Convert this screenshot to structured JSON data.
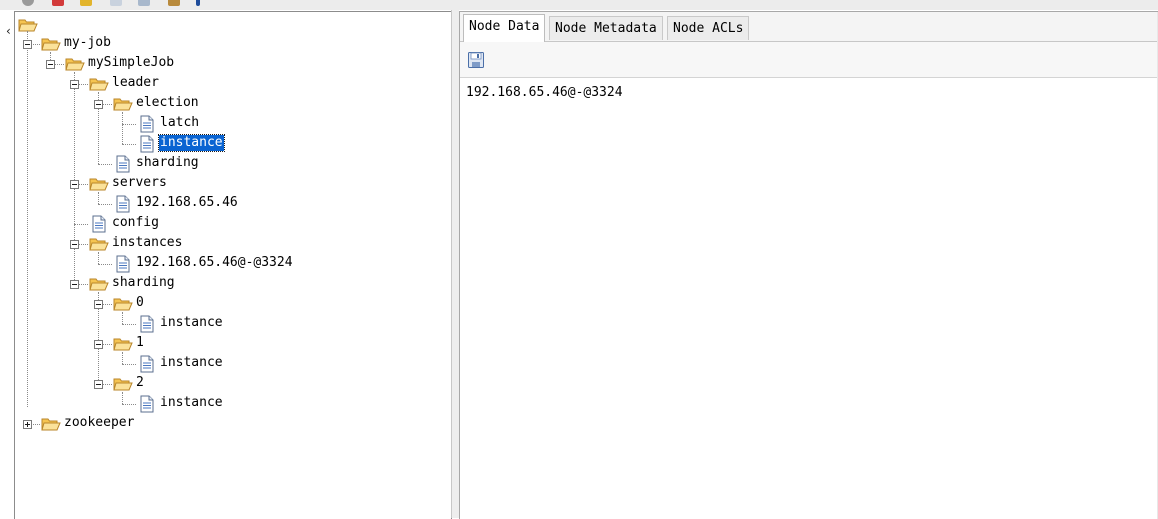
{
  "tree": {
    "nodes": [
      {
        "label": "my-job",
        "type": "folder",
        "expander": "minus"
      },
      {
        "label": "mySimpleJob",
        "type": "folder",
        "expander": "minus"
      },
      {
        "label": "leader",
        "type": "folder",
        "expander": "minus"
      },
      {
        "label": "election",
        "type": "folder",
        "expander": "minus"
      },
      {
        "label": "latch",
        "type": "file"
      },
      {
        "label": "instance",
        "type": "file",
        "selected": true
      },
      {
        "label": "sharding",
        "type": "file"
      },
      {
        "label": "servers",
        "type": "folder",
        "expander": "minus"
      },
      {
        "label": "192.168.65.46",
        "type": "file"
      },
      {
        "label": "config",
        "type": "file"
      },
      {
        "label": "instances",
        "type": "folder",
        "expander": "minus"
      },
      {
        "label": "192.168.65.46@-@3324",
        "type": "file"
      },
      {
        "label": "sharding",
        "type": "folder",
        "expander": "minus"
      },
      {
        "label": "0",
        "type": "folder",
        "expander": "minus"
      },
      {
        "label": "instance",
        "type": "file"
      },
      {
        "label": "1",
        "type": "folder",
        "expander": "minus"
      },
      {
        "label": "instance",
        "type": "file"
      },
      {
        "label": "2",
        "type": "folder",
        "expander": "minus"
      },
      {
        "label": "instance",
        "type": "file"
      },
      {
        "label": "zookeeper",
        "type": "folder",
        "expander": "plus"
      }
    ]
  },
  "tabs": [
    {
      "label": "Node Data",
      "active": true
    },
    {
      "label": "Node Metadata",
      "active": false
    },
    {
      "label": "Node ACLs",
      "active": false
    }
  ],
  "node_data": {
    "save_icon": "save-icon",
    "content": "192.168.65.46@-@3324"
  },
  "colors": {
    "selection": "#0a64d2",
    "folder": "#f5c451"
  }
}
